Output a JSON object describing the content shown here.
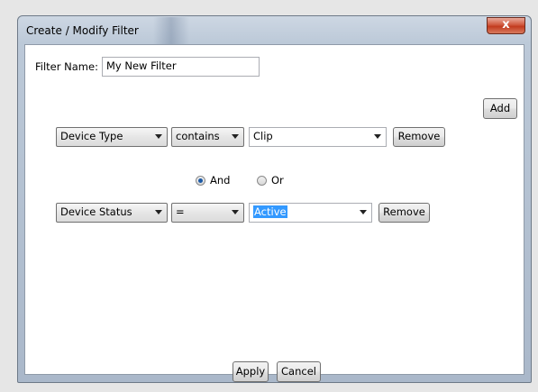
{
  "window": {
    "title": "Create / Modify Filter",
    "close_glyph": "x"
  },
  "filter_name": {
    "label": "Filter Name:",
    "value": "My New Filter"
  },
  "add_button": "Add",
  "rows": [
    {
      "field": "Device Type",
      "operator": "contains",
      "value": "Clip",
      "remove_label": "Remove"
    },
    {
      "field": "Device Status",
      "operator": "=",
      "value": "Active",
      "remove_label": "Remove"
    }
  ],
  "logic": {
    "and_label": "And",
    "or_label": "Or",
    "selected": "And"
  },
  "footer": {
    "apply_label": "Apply",
    "cancel_label": "Cancel"
  },
  "colors": {
    "selection": "#3399ff",
    "close_button": "#c23b1f"
  }
}
